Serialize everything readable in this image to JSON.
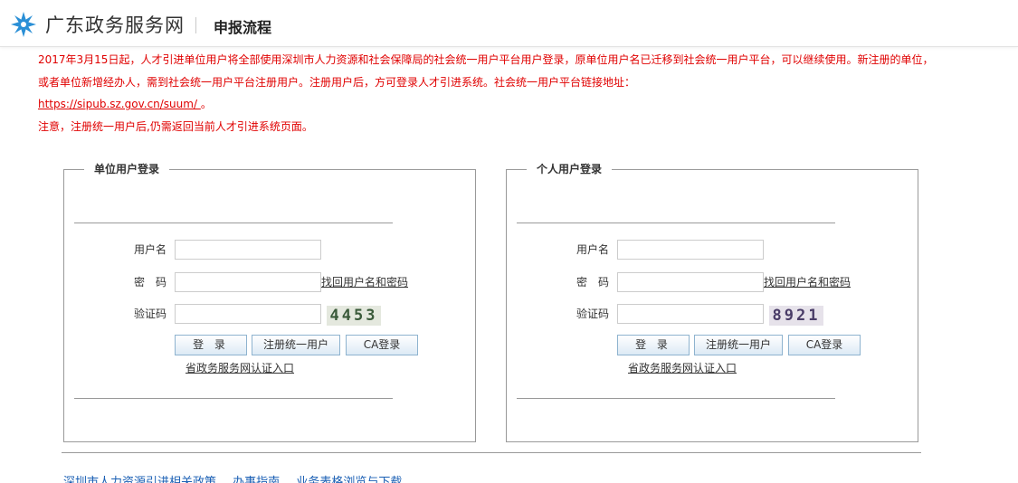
{
  "header": {
    "site_name": "广东政务服务网",
    "page_title": "申报流程",
    "logo_color": "#2a8fd6"
  },
  "notice": {
    "line1": "2017年3月15日起，人才引进单位用户将全部使用深圳市人力资源和社会保障局的社会统一用户平台用户登录，原单位用户名已迁移到社会统一用户平台，可以继续使用。新注册的单位，或者单位新增经办人，需到社会统一用户平台注册用户。注册用户后，方可登录人才引进系统。社会统一用户平台链接地址：",
    "link": "https://sipub.sz.gov.cn/suum/ ",
    "link_suffix": "。",
    "line2": "注意，注册统一用户后,仍需返回当前人才引进系统页面。",
    "color": "#e00000"
  },
  "unit_login": {
    "legend": "单位用户登录",
    "username_label": "用户名",
    "username_value": "",
    "password_label": "密　码",
    "password_value": "",
    "forgot_link": "找回用户名和密码",
    "captcha_label": "验证码",
    "captcha_value": "",
    "captcha_text": "4453",
    "login_button": "登 录",
    "register_button": "注册统一用户",
    "ca_button": "CA登录",
    "gov_link": "省政务服务网认证入口"
  },
  "person_login": {
    "legend": "个人用户登录",
    "username_label": "用户名",
    "username_value": "",
    "password_label": "密　码",
    "password_value": "",
    "forgot_link": "找回用户名和密码",
    "captcha_label": "验证码",
    "captcha_value": "",
    "captcha_text": "8921",
    "login_button": "登 录",
    "register_button": "注册统一用户",
    "ca_button": "CA登录",
    "gov_link": "省政务服务网认证入口"
  },
  "footer": {
    "links": [
      "深圳市人力资源引进相关政策",
      "办事指南",
      "业务表格浏览与下载"
    ],
    "link_color": "#1a5fb4"
  }
}
